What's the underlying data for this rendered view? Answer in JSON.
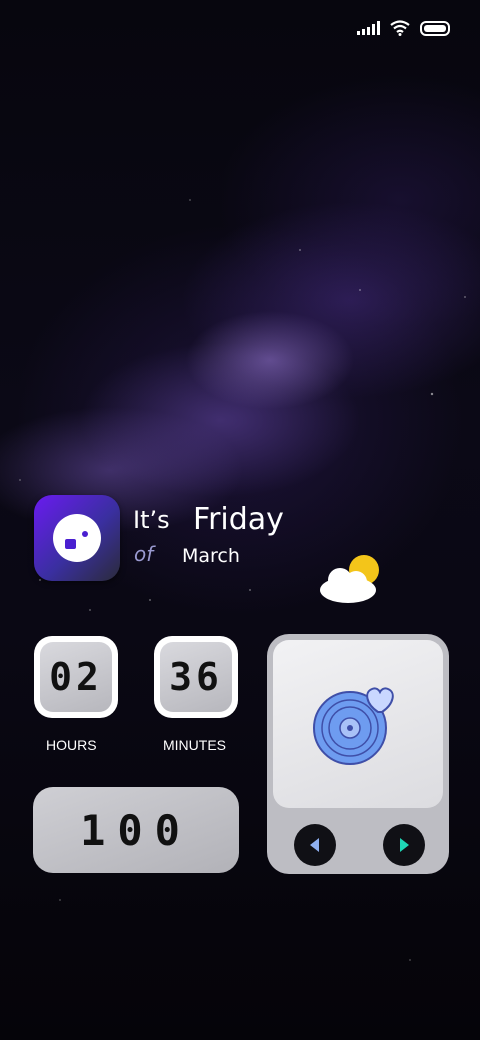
{
  "status_bar": {
    "icons": [
      "signal-icon",
      "wifi-icon",
      "battery-icon"
    ]
  },
  "date_widget": {
    "app_icon": "smiley-app-icon",
    "its": "It’s",
    "day": "Friday",
    "of": "of",
    "month": "March",
    "weather_icon": "partly-cloudy-icon"
  },
  "clock": {
    "hours": "02",
    "minutes": "36",
    "hours_label": "HOURS",
    "minutes_label": "MINUTES"
  },
  "counter": {
    "value": "100"
  },
  "music_widget": {
    "artwork_icon": "vinyl-heart-icon",
    "prev_icon": "previous-icon",
    "play_icon": "play-icon"
  },
  "colors": {
    "icon_gradient_start": "#6a1bf0",
    "prev_button": "#8fb0f0",
    "play_button": "#1fd6b5",
    "vinyl": "#6e9cf0"
  }
}
